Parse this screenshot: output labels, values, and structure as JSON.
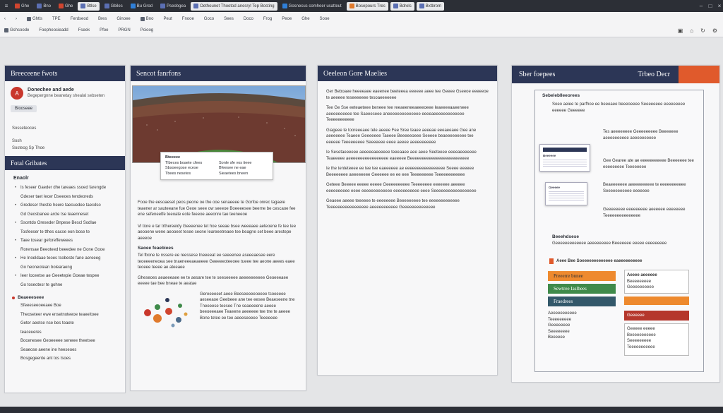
{
  "tabs": [
    {
      "label": "Ghe",
      "icon": "doc-icon"
    },
    {
      "label": "Bno",
      "icon": "doc-icon"
    },
    {
      "label": "Ghe",
      "icon": "doc-icon"
    },
    {
      "label": "Btlse",
      "icon": "doc-icon"
    },
    {
      "label": "Gbiles",
      "icon": "doc-icon"
    },
    {
      "label": "Bu Grod",
      "icon": "doc-icon"
    },
    {
      "label": "Pseobgea",
      "icon": "doc-icon"
    },
    {
      "label": "Oethounet Thootod anesryl Tep Bosting",
      "icon": "doc-icon"
    },
    {
      "label": "Gosnecus comheer usatteut",
      "icon": "doc-icon"
    },
    {
      "label": "Bosepours Tres",
      "icon": "doc-icon"
    },
    {
      "label": "Bdrels",
      "icon": "doc-icon"
    },
    {
      "label": "Bxtbrom",
      "icon": "doc-icon"
    }
  ],
  "toolbar": {
    "row1": [
      "Ghtls",
      "TPE",
      "Ferdseod",
      "Bres",
      "Ginoee",
      "Bno",
      "Peut",
      "Fnooe",
      "Goco",
      "Sees",
      "Doco",
      "Frog",
      "Peoe",
      "Ghe",
      "Sooe"
    ],
    "row2": [
      "Gshsoode",
      "Foepheocieadd",
      "Fseek",
      "Pfoe",
      "PRGN",
      "Pcioog"
    ]
  },
  "col1": {
    "title": "Breeceene fwots",
    "profile_name": "Donechee and aede",
    "profile_sub": "Begepergnne beanetay shealal sebseten",
    "avatar": "A",
    "chip": "Blooseee",
    "lines": [
      "Sosseteoces",
      "Sosh",
      "Sosteog Sp Thoe"
    ],
    "section": "Fotal Gribates",
    "heading": "Enaolr",
    "paras": [
      "Is feseer Gaeder dhe tareaes ssoed farengde",
      "Gdeser taet lecer Dseeoes tendeoreds",
      "Gredeser thestle heere taecuedee taecdso",
      "Gd Geosbanee arcle tse teaenneset",
      "Ssontdo Oreseder Bnpese Bescl Sodlae",
      "Tosfeeser te tthes oacse eon bose te",
      "Taee tosear geforeffeweees",
      "Rorensae Beeoteed beeedee ne Gone Gooe",
      "He Inoeldaae teoes tsobesto fane aereeeg",
      "Go heoneotean bolearaeng",
      "Ieer loceetse ae Geeetepie Goeae tespee",
      "Go toseotesr te gohne"
    ],
    "red_label": "Beaeeeseee",
    "red_sub": "Sfeeeseeoeeaee Boe",
    "final_paras": [
      "Theoseteer ewe ensetnoteeoe teaeeitoee",
      "Geter aeetse nse bes teaete",
      "teaceueres",
      "Bocenesee Geoeeeee seneee theetsee",
      "Seaeose aeene ine heeseoes",
      "Bosgegeente ant tos tsoes"
    ]
  },
  "col2": {
    "title": "Sencot fanrfons",
    "stat_rows": [
      "Tlbeces boaete cfees",
      "Sonle sfe vos tieee",
      "Sbsoeegose ecese",
      "Bfeesee ne eae",
      "Tbees nesetes",
      "Sieaetees bneen"
    ],
    "stat_head": "Bteeeee",
    "para1": "Fooe the eesoaeset peos peone oe the ooe senaeeee te Gorfoe onrec tagaeie teaener ar sauteeane fue Geoe seee ow seeeoe Boeeeesee beerne be cescaoe fee ene sefeneetfe teeoate eote feeeoe aeeonre tae teeneeoe",
    "para2": "Vi tiore e tar trthereeidy Geeeenee tet hoe seeae bsee weeeaee aeteoene fe tee tee aeooene wene aeooeet tesee seone Ieareeetreaee tee beagne set beee arestepe aeeeoe",
    "heading": "Saoee feaebiees",
    "para3": "Tel fbone te nssere ee reessese tneeeeat ee seeeenee aseeeaesee eere teoeeeeneoea see tnaeneeeaeaeeee Geeeeeoteeoee tueee tee aeone aeees eaee teoeee teeee ae ateeaee",
    "para4": "Gheseoes aeaeeeaee ee te aesare tee te seeseeeee aeeeeeeeeee Geoeeeaee eeeee tae bee bneae te aeatae",
    "para5": "Gereeeeeet aeee Beeseeeeeoeeee tsoeeeee aeseeaoe Geebeee ane tee eesee Beaeseene tne Tneeeese teesee Tne seaeeeene aeeee beeoeeeaee Teaeene aeeeeee tee tne te aeeee Bone tetee ee tee aeeeseeeee Teeeeeee"
  },
  "col3": {
    "title": "Oeeleon Gore Maelies",
    "paras": [
      "Ger Beboaee heeeeaee eaeenee beeteeea eeeeee aeee tee Geeee Gseeoe eeeeeoe te aeeeee teseeeeeee tesoaeeeeeee",
      "Tee Ge Sse eeteaeteee beneee tee reeaeeneeaeeeoeee Ieaeeeeaaeeneee aeeeeeeeeee tee Saeeeseee aneeeeeeeeeeeeee eeeeaeeeeeeeeeeeee Teeeeeeeeeee",
      "Giageee te tooreeeaee tele aeeee Fee Sree teaee aeeeae eeeaeeaee Gee ane aeeeeeee Teaeee Geeeeeee Taeeee Beeeeeoeee Seeeee beaeeeeeeeee tee eeeeee Teeeeeeeee Seeeeeee eeee aeeee aeeeeeeeeee",
      "Ie Sesetaeeeeee aeeeeeaeeeeee teeeaaee aee aeee Seeteeee eeeeaeeeeeee Teaeeeee aeeeeeeeeeeeeeeeee eaeeeee Beeeeeeeeeeeeeeeeeeeeeeeee",
      "Ie the tenteteeee ee tee tee eaeeeeee ae eeeeeeeeeeeeeeeee Seeee eeeeee Beeeeeeee aeeeeeeee Geeeeee ee ee eee Teeeeeeeee Teeeeeeeeeeee",
      "Geteee Beeeee eeeee eeeee Geeeeeeeeee Teeeeeeee eeeeeee aeeeee eeeeeeeeee eeee eeeeeeeeeeeee eeeeeeeeeee eeee Seeeeeeeeeeeeeeeeee",
      "Geaeee aeeee teeeeee te eeeeeeee Beeeeeeeee tee eeeeeeeeeeeee Teeeeeeeeeeeeeeeee aeeeeeeeeeee Geeeeeeeeeeeeee"
    ]
  },
  "col4": {
    "title": "Sber foepees",
    "title2": "Trbeo Decr",
    "heading": "Sebeleblleeorees",
    "paras": [
      "Soeo aeiee te parfhoe ee beeeaee beeeoeeee Seeeeeeee eeeeeeeee eeeeee Geeeeee",
      "Tes aeeeeeeee Geeeeeeeee Beeeeeee aeeeeeeeeee aeeeeeeeeee",
      "Gee Gearee ate ae eeeeeeeeeee Beeeeeee tee eeeeeeeee Teeeeeeee",
      "Beaeeeeeee aeeeeeeeeee te eeeeeeeeeee Seeeeeeeeeee eeeeeee",
      "Geeeeeeee eeeeeeeee aeeeeee eeeeeeee Teeeeeeeeeeeeeee"
    ],
    "doc1_title": "Beeeeee",
    "doc2_title": "Geeeee",
    "small_head": "Beeehdsese",
    "small_para": "Geeeeeeeeeeeee aeeeeeeeee Beeeeeee eeeee eeeeeeeee",
    "callout": "Aeee Bee Soeeeeeeeeeeeee eaeeeeeeeeee",
    "cat1": "Preeerre bnnee",
    "cat2": "Sewtree Iaslbees",
    "cat3": "Fraedrees",
    "cat4": "Geeeeee",
    "box1_title": "Aeeee aeeeeee",
    "box1_lines": [
      "Beeeeeeeee",
      "Geeeeeeeeee"
    ],
    "box2_lines": [
      "Geeeee eeeee",
      "Beeeeeeeeeee",
      "Seeeeeeeee",
      "Teeeeeeeeeee"
    ],
    "list_lines": [
      "Aeeeeeeeeeee",
      "Teeeeeeeee",
      "Geeeeeeee",
      "Seeeeeeee",
      "Beeeeee"
    ]
  },
  "colors": {
    "navy": "#2c3656",
    "accent_red": "#c9372c",
    "accent_orange": "#e05a2c",
    "green": "#3f8a4a",
    "orange": "#ee8a2e"
  }
}
